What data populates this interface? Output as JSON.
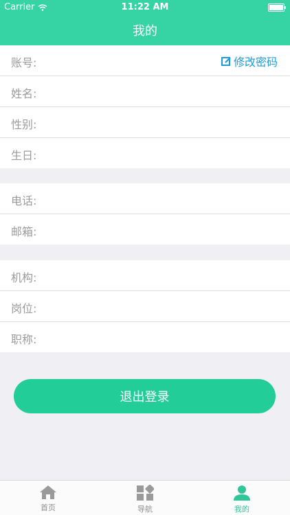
{
  "status_bar": {
    "carrier": "Carrier",
    "time": "11:22 AM"
  },
  "nav": {
    "title": "我的"
  },
  "profile": {
    "group1": [
      {
        "label": "账号:"
      },
      {
        "label": "姓名:"
      },
      {
        "label": "性别:"
      },
      {
        "label": "生日:"
      }
    ],
    "edit_password": "修改密码",
    "group2": [
      {
        "label": "电话:"
      },
      {
        "label": "邮箱:"
      }
    ],
    "group3": [
      {
        "label": "机构:"
      },
      {
        "label": "岗位:"
      },
      {
        "label": "职称:"
      }
    ]
  },
  "logout_button": "退出登录",
  "tabs": [
    {
      "label": "首页",
      "icon": "home-icon"
    },
    {
      "label": "导航",
      "icon": "grid-icon"
    },
    {
      "label": "我的",
      "icon": "person-icon",
      "active": true
    }
  ],
  "colors": {
    "header": "#36d3a4",
    "button": "#23cd98",
    "link": "#1d9bd8",
    "tab_active": "#33c59a",
    "background": "#efeff4"
  }
}
